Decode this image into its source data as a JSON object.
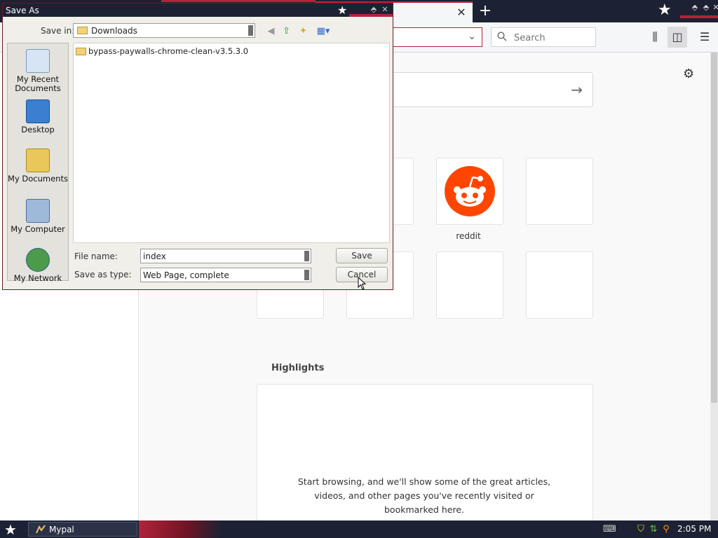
{
  "browser": {
    "tab_close": "✕",
    "new_tab": "+",
    "search": {
      "placeholder": "Search"
    },
    "tiles": [
      {
        "label": "reddit"
      }
    ],
    "highlights": {
      "title": "Highlights",
      "empty_text": "Start browsing, and we'll show some of the great articles, videos, and other pages you've recently visited or bookmarked here."
    }
  },
  "dialog": {
    "title": "Save As",
    "save_in_label": "Save in:",
    "save_in_value": "Downloads",
    "places": [
      {
        "label": "My Recent Documents"
      },
      {
        "label": "Desktop"
      },
      {
        "label": "My Documents"
      },
      {
        "label": "My Computer"
      },
      {
        "label": "My Network"
      }
    ],
    "files": [
      {
        "name": "bypass-paywalls-chrome-clean-v3.5.3.0"
      }
    ],
    "file_name_label": "File name:",
    "file_name_value": "index",
    "save_type_label": "Save as type:",
    "save_type_value": "Web Page, complete",
    "save_button": "Save",
    "cancel_button": "Cancel"
  },
  "taskbar": {
    "task_label": "Mypal",
    "clock": "2:05 PM"
  },
  "colors": {
    "accent_red": "#b3243a",
    "titlebar": "#1c2233",
    "reddit": "#ff4500"
  }
}
